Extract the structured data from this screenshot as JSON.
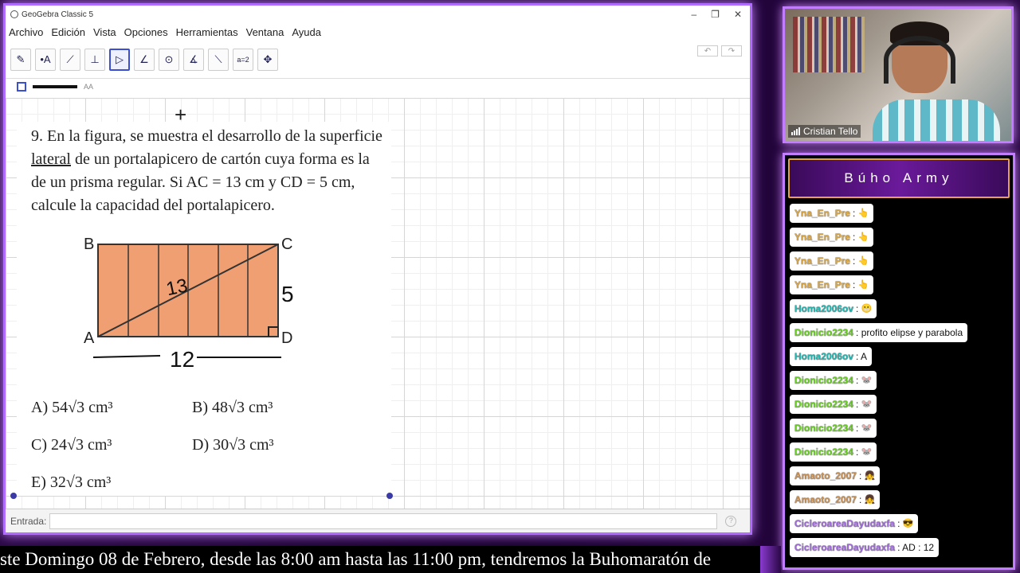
{
  "window": {
    "title": "GeoGebra Classic 5",
    "controls": [
      "–",
      "❐",
      "✕"
    ]
  },
  "menu": [
    "Archivo",
    "Edición",
    "Vista",
    "Opciones",
    "Herramientas",
    "Ventana",
    "Ayuda"
  ],
  "toolbar": {
    "tools": [
      {
        "name": "move-tool",
        "glyph": "✎"
      },
      {
        "name": "point-tool",
        "glyph": "•A"
      },
      {
        "name": "line-tool",
        "glyph": "⟋"
      },
      {
        "name": "perpendicular-tool",
        "glyph": "⊥"
      },
      {
        "name": "polygon-tool",
        "glyph": "▷"
      },
      {
        "name": "angle-tool",
        "glyph": "∠"
      },
      {
        "name": "circle-tool",
        "glyph": "⊙"
      },
      {
        "name": "angle-measure-tool",
        "glyph": "∡"
      },
      {
        "name": "reflect-tool",
        "glyph": "⟍"
      },
      {
        "name": "slider-tool",
        "glyph": "a=2"
      },
      {
        "name": "move-graphics-tool",
        "glyph": "✥"
      }
    ],
    "active_index": 4,
    "undo": "↶",
    "redo": "↷"
  },
  "style_bar": {
    "text_size": "AA"
  },
  "problem": {
    "line1": "9. En la figura, se muestra el desarrollo de la superficie",
    "line2_underlined": "lateral",
    "line2_rest": " de un portalapicero de cartón cuya forma es la",
    "line3": "de un prisma regular. Si AC = 13 cm y CD = 5 cm,",
    "line4": "calcule la capacidad del portalapicero.",
    "figure": {
      "labels": {
        "B": "B",
        "C": "C",
        "A": "A",
        "D": "D"
      },
      "diag": "13",
      "side": "5",
      "base": "12"
    },
    "options": {
      "a": "A) 54√3 cm³",
      "b": "B) 48√3 cm³",
      "c": "C) 24√3 cm³",
      "d": "D) 30√3 cm³",
      "e": "E) 32√3 cm³"
    }
  },
  "input_bar": {
    "label": "Entrada:",
    "help": "?"
  },
  "camera": {
    "name": "Cristian Tello"
  },
  "chat": {
    "title": "Búho Army",
    "messages": [
      {
        "user": "Yna_En_Pre",
        "text": " :",
        "cls": "u-yna",
        "emoji": "👆"
      },
      {
        "user": "Yna_En_Pre",
        "text": " :",
        "cls": "u-yna",
        "emoji": "👆"
      },
      {
        "user": "Yna_En_Pre",
        "text": " :",
        "cls": "u-yna",
        "emoji": "👆"
      },
      {
        "user": "Yna_En_Pre",
        "text": " :",
        "cls": "u-yna",
        "emoji": "👆"
      },
      {
        "user": "Homa2006ov",
        "text": " :",
        "cls": "u-homa",
        "emoji": "😬"
      },
      {
        "user": "Dionicio2234",
        "text": " : profito elipse y parabola",
        "cls": "u-dio",
        "emoji": ""
      },
      {
        "user": "Homa2006ov",
        "text": " : A",
        "cls": "u-homa",
        "emoji": ""
      },
      {
        "user": "Dionicio2234",
        "text": " :",
        "cls": "u-dio",
        "emoji": "🐭"
      },
      {
        "user": "Dionicio2234",
        "text": " :",
        "cls": "u-dio",
        "emoji": "🐭"
      },
      {
        "user": "Dionicio2234",
        "text": " :",
        "cls": "u-dio",
        "emoji": "🐭"
      },
      {
        "user": "Dionicio2234",
        "text": " :",
        "cls": "u-dio",
        "emoji": "🐭"
      },
      {
        "user": "Amaoto_2007",
        "text": " :",
        "cls": "u-ama",
        "emoji": "👧"
      },
      {
        "user": "Amaoto_2007",
        "text": " :",
        "cls": "u-ama",
        "emoji": "👧"
      },
      {
        "user": "CicleroareaDayudaxfa",
        "text": " :",
        "cls": "u-cic",
        "emoji": "😎"
      },
      {
        "user": "CicleroareaDayudaxfa",
        "text": " : AD : 12",
        "cls": "u-cic",
        "emoji": ""
      }
    ]
  },
  "ticker": "ste Domingo 08 de Febrero, desde las 8:00 am hasta las 11:00 pm, tendremos la Buhomaratón de"
}
